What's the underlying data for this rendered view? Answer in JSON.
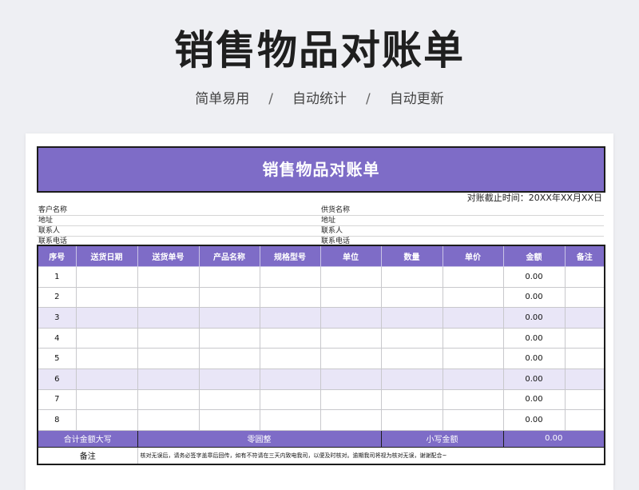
{
  "header": {
    "title": "销售物品对账单",
    "tags": [
      "简单易用",
      "自动统计",
      "自动更新"
    ],
    "separator": "/"
  },
  "sheet": {
    "banner": "销售物品对账单",
    "cutoff": "对账截止时间：20XX年XX月XX日",
    "info_left": [
      "客户名称",
      "地址",
      "联系人",
      "联系电话"
    ],
    "info_right": [
      "供货名称",
      "地址",
      "联系人",
      "联系电话"
    ],
    "columns": [
      "序号",
      "送货日期",
      "送货单号",
      "产品名称",
      "规格型号",
      "单位",
      "数量",
      "单价",
      "金额",
      "备注"
    ],
    "rows": [
      {
        "no": "1",
        "amount": "0.00"
      },
      {
        "no": "2",
        "amount": "0.00"
      },
      {
        "no": "3",
        "amount": "0.00"
      },
      {
        "no": "4",
        "amount": "0.00"
      },
      {
        "no": "5",
        "amount": "0.00"
      },
      {
        "no": "6",
        "amount": "0.00"
      },
      {
        "no": "7",
        "amount": "0.00"
      },
      {
        "no": "8",
        "amount": "0.00"
      }
    ],
    "total": {
      "label_upper": "合计金额大写",
      "value_upper": "零圆整",
      "label_lower": "小写金额",
      "value_lower": "0.00"
    },
    "note": {
      "label": "备注",
      "text": "核对无误后，请务必签字盖章后回传，如有不符请在三天内致电我司，以便及时核对。逾期我司将视为核对无误，谢谢配合~"
    }
  },
  "colors": {
    "accent": "#7e6cc7",
    "alt_row": "#e9e6f7"
  }
}
